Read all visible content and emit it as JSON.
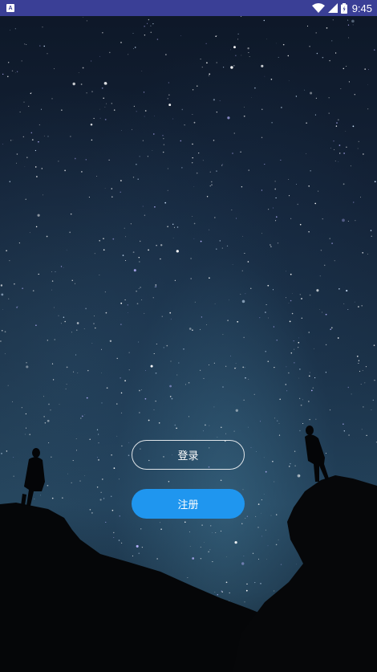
{
  "status_bar": {
    "time": "9:45",
    "notification_icon": "android-notification-icon",
    "wifi_icon": "wifi-icon",
    "signal_icon": "cell-signal-icon",
    "battery_icon": "battery-icon",
    "background_color": "#3a3f96"
  },
  "background": {
    "description_icon": "starry-night-background"
  },
  "actions": {
    "login_label": "登录",
    "register_label": "注册",
    "register_color": "#1f96ef"
  }
}
